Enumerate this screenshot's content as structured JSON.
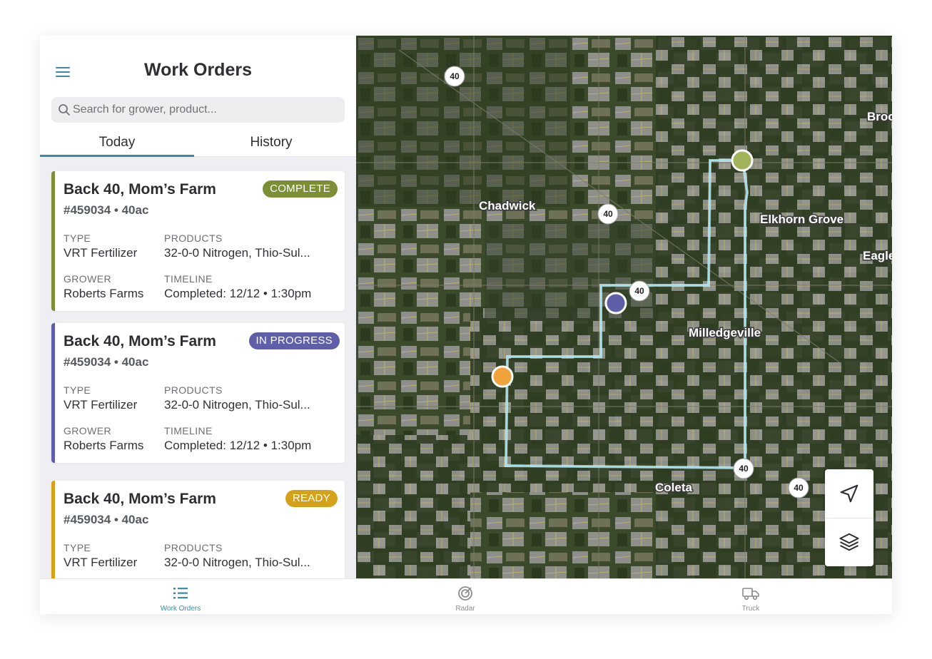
{
  "header": {
    "title": "Work Orders",
    "menu_icon": "hamburger-menu-icon"
  },
  "search": {
    "placeholder": "Search for grower, product...",
    "icon": "search-icon"
  },
  "tabs": [
    {
      "label": "Today",
      "active": true
    },
    {
      "label": "History",
      "active": false
    }
  ],
  "work_orders": [
    {
      "title": "Back 40, Mom’s Farm",
      "subtitle": "#459034 • 40ac",
      "status": "COMPLETE",
      "status_color": "#7c8f37",
      "type_label": "TYPE",
      "type": "VRT Fertilizer",
      "products_label": "PRODUCTS",
      "products": "32-0-0 Nitrogen, Thio-Sul...",
      "grower_label": "GROWER",
      "grower": "Roberts Farms",
      "timeline_label": "TIMELINE",
      "timeline": "Completed: 12/12 • 1:30pm"
    },
    {
      "title": "Back 40, Mom’s Farm",
      "subtitle": "#459034 • 40ac",
      "status": "IN PROGRESS",
      "status_color": "#5e5fa8",
      "type_label": "TYPE",
      "type": "VRT Fertilizer",
      "products_label": "PRODUCTS",
      "products": "32-0-0 Nitrogen, Thio-Sul...",
      "grower_label": "GROWER",
      "grower": "Roberts Farms",
      "timeline_label": "TIMELINE",
      "timeline": "Completed: 12/12 • 1:30pm"
    },
    {
      "title": "Back 40, Mom’s Farm",
      "subtitle": "#459034 • 40ac",
      "status": "READY",
      "status_color": "#d4a11a",
      "type_label": "TYPE",
      "type": "VRT Fertilizer",
      "products_label": "PRODUCTS",
      "products": "32-0-0 Nitrogen, Thio-Sul..."
    }
  ],
  "map": {
    "towns": [
      "Chadwick",
      "Elkhorn Grove",
      "Eagle",
      "Brook",
      "Milledgeville",
      "Coleta"
    ],
    "route_shield": "40",
    "markers": [
      {
        "name": "complete-marker",
        "color": "#a3b35a"
      },
      {
        "name": "in-progress-marker",
        "color": "#5e5fa8"
      },
      {
        "name": "ready-marker",
        "color": "#f0a33b"
      }
    ],
    "route_color": "#9be3ef",
    "controls": [
      "locate-icon",
      "layers-icon"
    ]
  },
  "bottom_nav": [
    {
      "label": "Work Orders",
      "icon": "list-icon",
      "active": true
    },
    {
      "label": "Radar",
      "icon": "radar-icon",
      "active": false
    },
    {
      "label": "Truck",
      "icon": "truck-icon",
      "active": false
    }
  ]
}
